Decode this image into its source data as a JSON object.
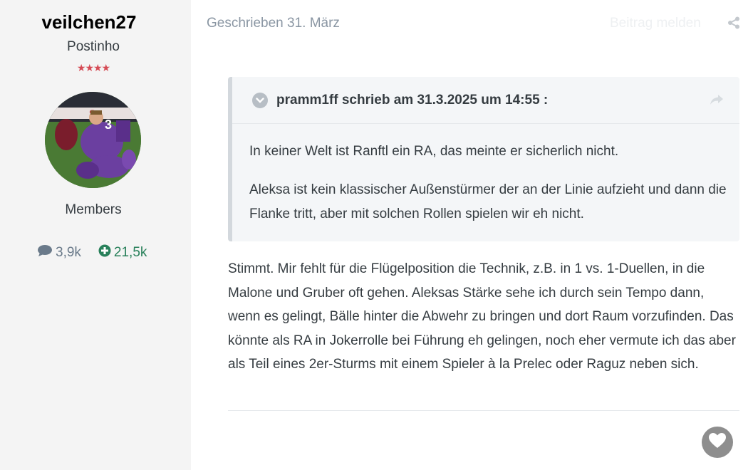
{
  "author": {
    "username": "veilchen27",
    "rank_title": "Postinho",
    "rank_stars": "★★★★",
    "group": "Members",
    "posts_count": "3,9k",
    "reputation": "21,5k"
  },
  "post": {
    "date": "Geschrieben 31. März",
    "report_label": "Beitrag melden",
    "quote": {
      "citation": "pramm1ff schrieb am 31.3.2025 um 14:55 :",
      "paragraphs": [
        "In keiner Welt ist Ranftl ein RA, das meinte er sicherlich nicht.",
        "Aleksa ist kein klassischer Außenstürmer der an der Linie aufzieht und dann die Flanke tritt, aber mit solchen Rollen spielen wir eh nicht."
      ]
    },
    "body": "Stimmt. Mir fehlt für die Flügelposition die Technik, z.B. in 1 vs. 1-Duellen, in die Malone und Gruber oft gehen. Aleksas Stärke sehe ich durch sein Tempo dann, wenn es gelingt, Bälle hinter die Abwehr zu bringen und dort Raum vorzufinden. Das könnte als RA in Jokerrolle bei Führung eh gelingen, noch eher vermute ich das aber als Teil eines 2er-Sturms mit einem Spieler à la Prelec oder Raguz neben sich."
  },
  "colors": {
    "sidebar_bg": "#f4f4f4",
    "stars": "#d54b55",
    "reputation": "#28805a",
    "quote_bg": "#f4f6f8"
  },
  "icons": {
    "posts": "comment-icon",
    "reputation": "plus-circle-icon",
    "share": "share-icon",
    "quote_toggle": "chevron-down-icon",
    "quote_jump": "share-arrow-icon",
    "like": "heart-icon"
  }
}
